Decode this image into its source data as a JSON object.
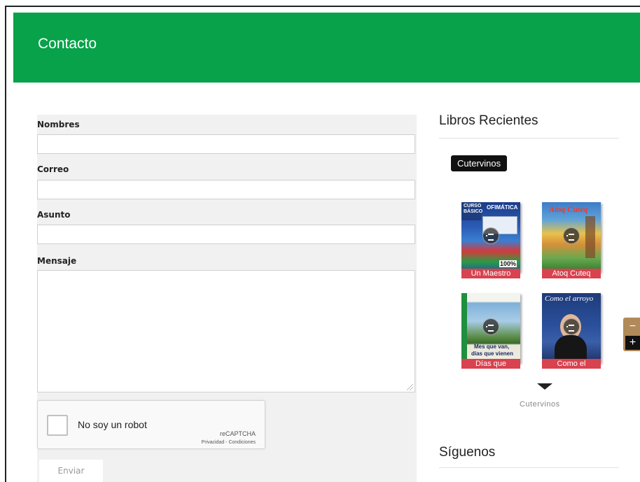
{
  "header": {
    "title": "Contacto"
  },
  "form": {
    "name_label": "Nombres",
    "email_label": "Correo",
    "subject_label": "Asunto",
    "message_label": "Mensaje",
    "name_value": "",
    "email_value": "",
    "subject_value": "",
    "message_value": "",
    "submit_label": "Enviar"
  },
  "captcha": {
    "label": "No soy un robot",
    "brand": "reCAPTCHA",
    "privacy": "Privacidad",
    "separator": " - ",
    "terms": "Condiciones"
  },
  "sidebar": {
    "recent_title": "Libros Recientes",
    "label_tag": "Cutervinos",
    "books": [
      {
        "caption": "Un Maestro",
        "cover_line1": "CURSO",
        "cover_line2": "BÁSICO",
        "cover_line3": "OFIMÁTICA",
        "cover_badge": "100%"
      },
      {
        "caption": "Atoq Cuteq",
        "cover_line1": "Atoq Cuteq"
      },
      {
        "caption": "Días que",
        "cover_line1": "Mes que van,",
        "cover_line2": "días que vienen"
      },
      {
        "caption": "Como el",
        "cover_line1": "Como el arroyo"
      }
    ],
    "more_label": "Cutervinos",
    "follow_title": "Síguenos"
  },
  "zoom": {
    "minus": "−",
    "plus": "+"
  },
  "colors": {
    "header_green": "#07a24a",
    "caption_red": "#d9424f",
    "zoom_brown": "#b08a5a"
  }
}
